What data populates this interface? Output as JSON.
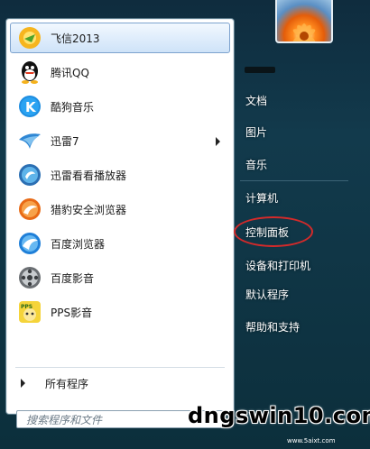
{
  "start_menu": {
    "programs": [
      {
        "label": "飞信2013",
        "icon": "fetion-icon",
        "selected": true,
        "has_submenu": false
      },
      {
        "label": "腾讯QQ",
        "icon": "qq-icon",
        "selected": false,
        "has_submenu": false
      },
      {
        "label": "酷狗音乐",
        "icon": "kugou-icon",
        "selected": false,
        "has_submenu": false
      },
      {
        "label": "迅雷7",
        "icon": "thunder-icon",
        "selected": false,
        "has_submenu": true
      },
      {
        "label": "迅雷看看播放器",
        "icon": "xunlei-kankan-icon",
        "selected": false,
        "has_submenu": false
      },
      {
        "label": "猎豹安全浏览器",
        "icon": "liebao-browser-icon",
        "selected": false,
        "has_submenu": false
      },
      {
        "label": "百度浏览器",
        "icon": "baidu-browser-icon",
        "selected": false,
        "has_submenu": false
      },
      {
        "label": "百度影音",
        "icon": "baidu-player-icon",
        "selected": false,
        "has_submenu": false
      },
      {
        "label": "PPS影音",
        "icon": "pps-icon",
        "selected": false,
        "has_submenu": false
      }
    ],
    "all_programs_label": "所有程序",
    "search_placeholder": "搜索程序和文件",
    "right_items": [
      {
        "label": "文档"
      },
      {
        "label": "图片"
      },
      {
        "label": "音乐"
      },
      {
        "label": "计算机"
      },
      {
        "label": "控制面板",
        "highlighted": true
      },
      {
        "label": "设备和打印机"
      },
      {
        "label": "默认程序"
      },
      {
        "label": "帮助和支持"
      }
    ],
    "highlight_color": "#d42a2a"
  },
  "watermark": {
    "text": "dngswin10.com",
    "sub_text": "www.5aixt.com"
  }
}
